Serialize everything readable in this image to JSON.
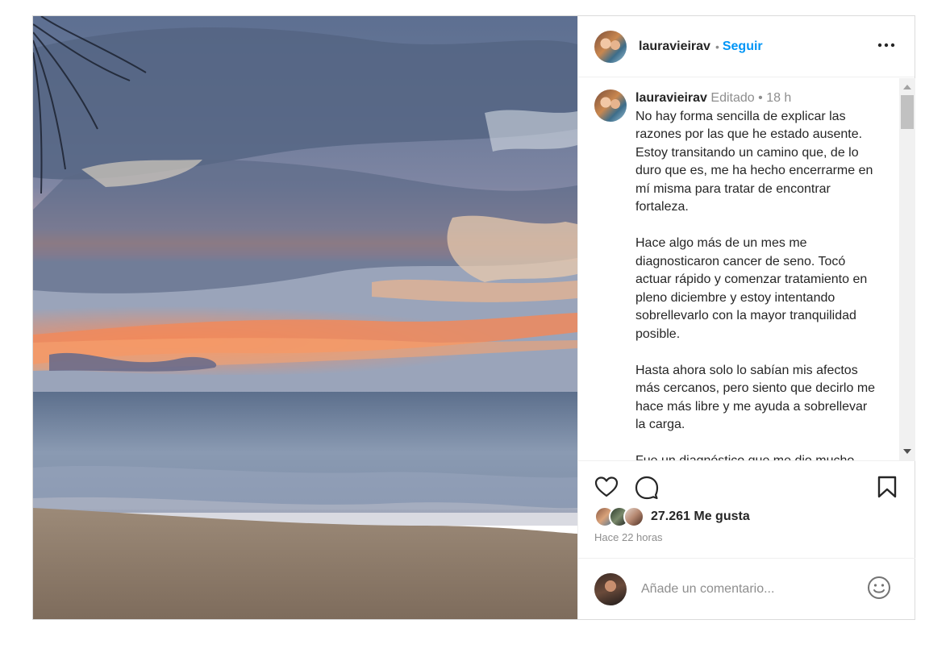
{
  "post": {
    "username": "lauravieirav",
    "follow_label": "Seguir",
    "separator": "•",
    "caption": {
      "username": "lauravieirav",
      "edited_label": "Editado",
      "separator": "•",
      "age": "18 h",
      "paragraphs": [
        "No hay forma sencilla de explicar las razones por las que he estado ausente. Estoy transitando un camino que, de lo duro que es, me ha hecho encerrarme en mí misma para tratar de encontrar fortaleza.",
        "Hace algo más de un mes me diagnosticaron cancer de seno. Tocó actuar rápido y comenzar tratamiento en pleno diciembre y estoy intentando sobrellevarlo con la mayor tranquilidad posible.",
        "Hasta ahora solo lo sabían mis afectos más cercanos, pero siento que decirlo me hace más libre y me ayuda a sobrellevar la carga.",
        "Fue un diagnóstico que me dio mucho"
      ]
    },
    "likes_label": "27.261 Me gusta",
    "timestamp": "Hace 22 horas",
    "comment_placeholder": "Añade un comentario..."
  },
  "icons": {
    "more": "more-options-icon",
    "like": "heart-icon",
    "comment": "comment-icon",
    "save": "bookmark-icon",
    "emoji": "emoji-icon"
  },
  "colors": {
    "link": "#0095f6",
    "text": "#262626",
    "muted": "#8e8e8e",
    "border": "#dbdbdb"
  }
}
